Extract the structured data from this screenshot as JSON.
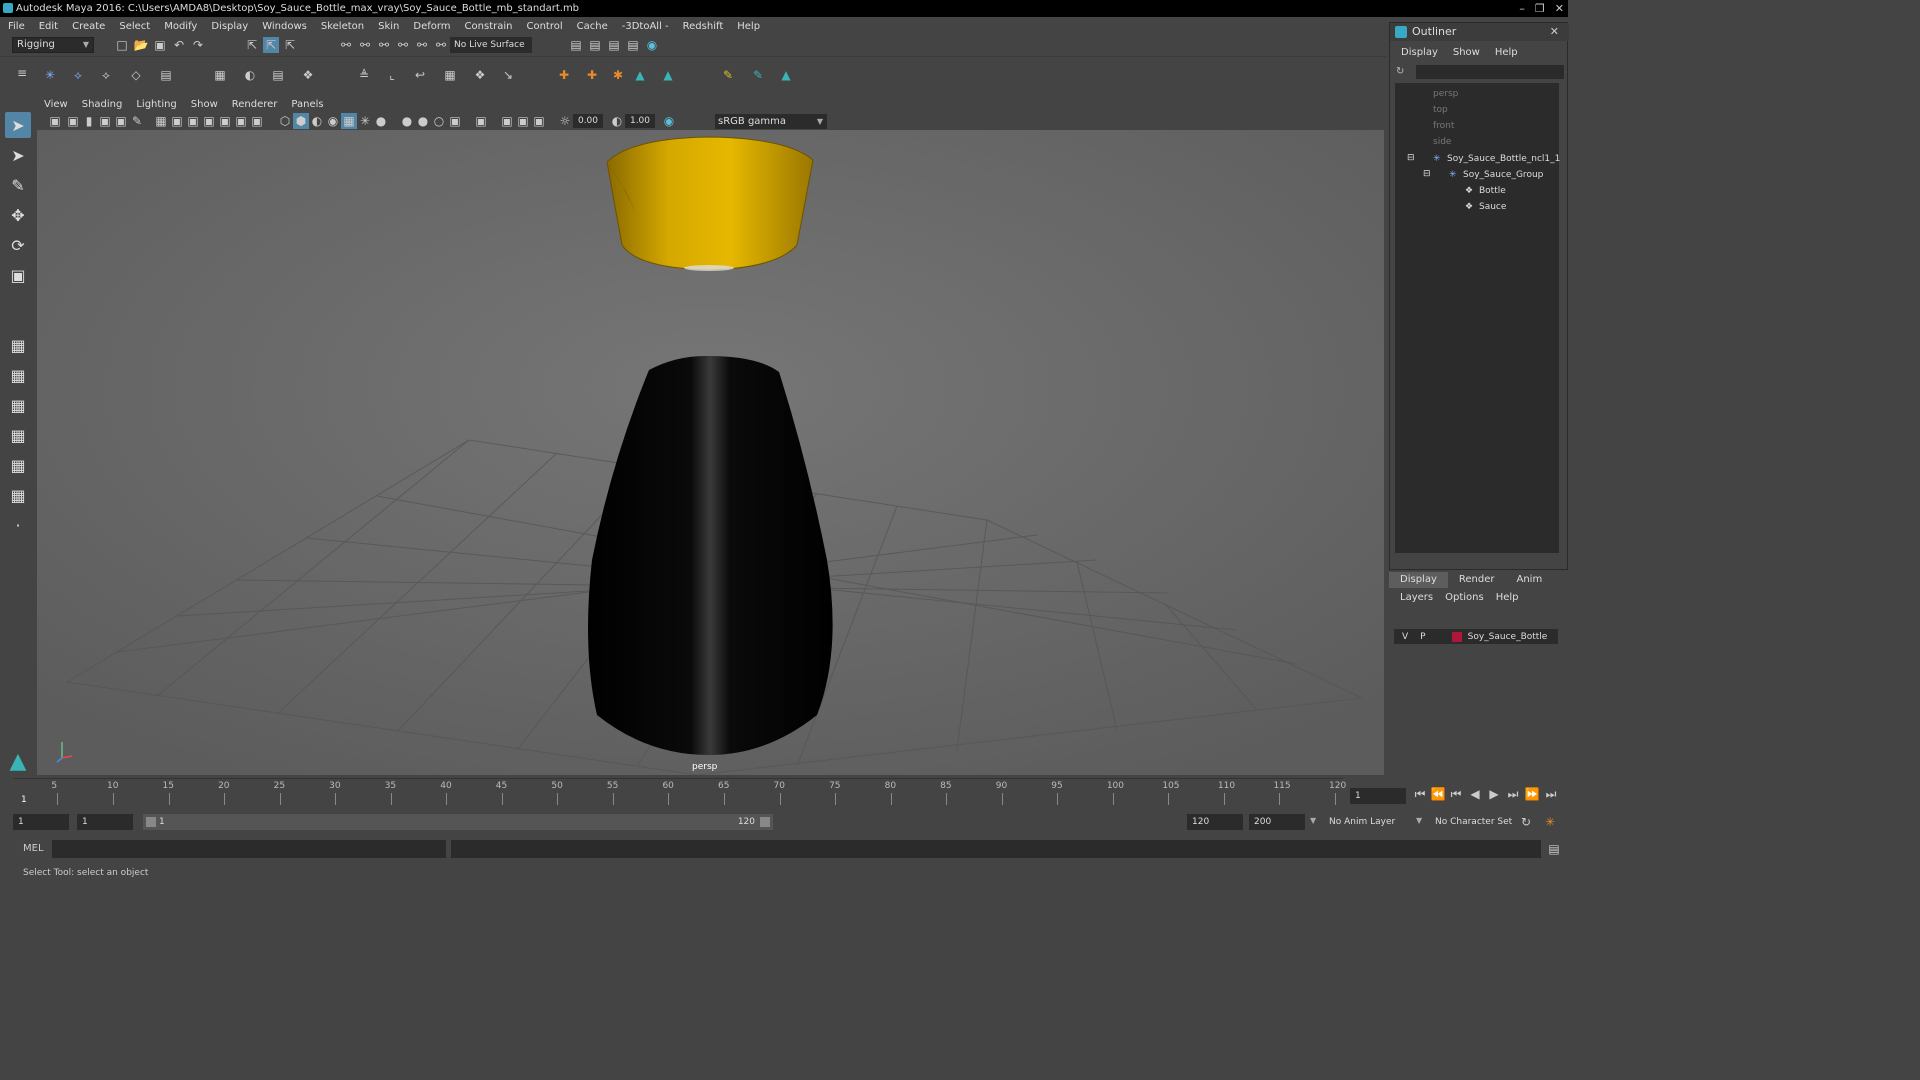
{
  "window": {
    "title": "Autodesk Maya 2016: C:\\Users\\AMDA8\\Desktop\\Soy_Sauce_Bottle_max_vray\\Soy_Sauce_Bottle_mb_standart.mb"
  },
  "menubar": [
    "File",
    "Edit",
    "Create",
    "Select",
    "Modify",
    "Display",
    "Windows",
    "Skeleton",
    "Skin",
    "Deform",
    "Constrain",
    "Control",
    "Cache",
    "-3DtoAll -",
    "Redshift",
    "Help"
  ],
  "toolbar": {
    "mode": "Rigging",
    "live_surface": "No Live Surface"
  },
  "panel": {
    "menus": [
      "View",
      "Shading",
      "Lighting",
      "Show",
      "Renderer",
      "Panels"
    ],
    "exposure": "0.00",
    "gamma": "1.00",
    "color_space": "sRGB gamma",
    "camera": "persp"
  },
  "outliner": {
    "title": "Outliner",
    "menus": [
      "Display",
      "Show",
      "Help"
    ],
    "items": [
      {
        "label": "persp",
        "dim": true
      },
      {
        "label": "top",
        "dim": true
      },
      {
        "label": "front",
        "dim": true
      },
      {
        "label": "side",
        "dim": true
      },
      {
        "label": "Soy_Sauce_Bottle_ncl1_1",
        "dim": false
      },
      {
        "label": "Soy_Sauce_Group",
        "dim": false
      },
      {
        "label": "Bottle",
        "dim": false
      },
      {
        "label": "Sauce",
        "dim": false
      }
    ]
  },
  "layers": {
    "tabs": [
      "Display",
      "Render",
      "Anim"
    ],
    "active_tab": "Display",
    "menus": [
      "Layers",
      "Options",
      "Help"
    ],
    "layer": {
      "v": "V",
      "p": "P",
      "name": "Soy_Sauce_Bottle",
      "color": "#b0163a"
    }
  },
  "timeline": {
    "ticks": [
      "5",
      "10",
      "15",
      "20",
      "25",
      "30",
      "35",
      "40",
      "45",
      "50",
      "55",
      "60",
      "65",
      "70",
      "75",
      "80",
      "85",
      "90",
      "95",
      "100",
      "105",
      "110",
      "115",
      "120"
    ],
    "start_marker": "1",
    "current_frame": "1"
  },
  "range": {
    "start": "1",
    "anim_start": "1",
    "slider_start": "1",
    "slider_end": "120",
    "anim_end": "120",
    "end": "200",
    "anim_layer": "No Anim Layer",
    "char_set": "No Character Set"
  },
  "cmdline": {
    "label": "MEL"
  },
  "status": {
    "text": "Select Tool: select an object"
  }
}
